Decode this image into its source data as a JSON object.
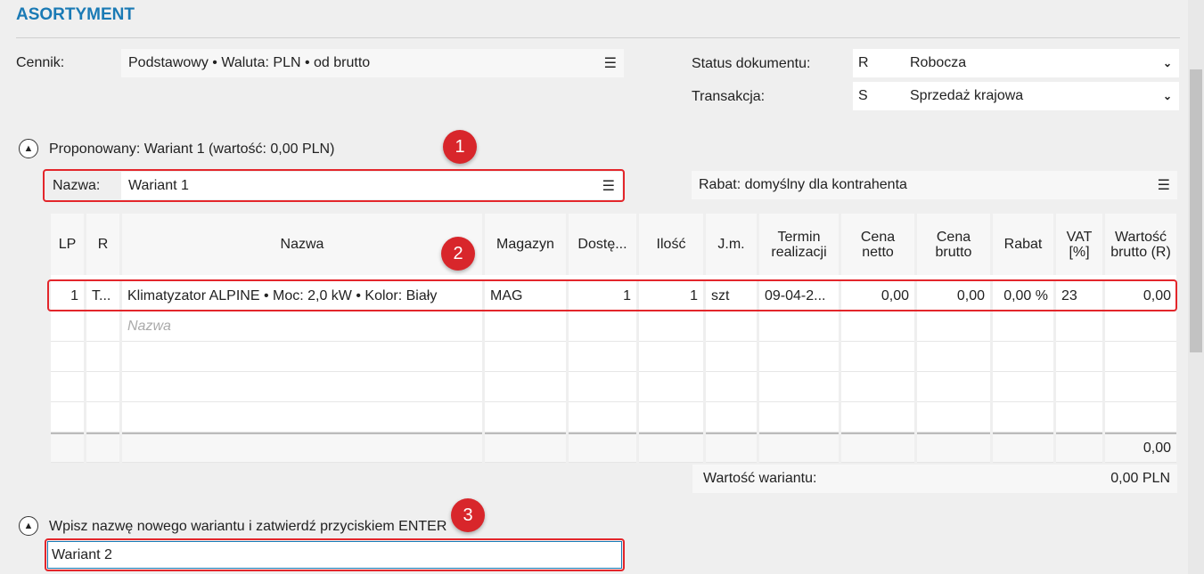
{
  "section_title": "ASORTYMENT",
  "cennik": {
    "label": "Cennik:",
    "value": "Podstawowy • Waluta: PLN • od brutto"
  },
  "status": {
    "label": "Status dokumentu:",
    "code": "R",
    "value": "Robocza"
  },
  "transakcja": {
    "label": "Transakcja:",
    "code": "S",
    "value": "Sprzedaż krajowa"
  },
  "proposed": {
    "title": "Proponowany: Wariant 1 (wartość: 0,00 PLN)",
    "name_label": "Nazwa:",
    "name_value": "Wariant 1",
    "rabat": "Rabat: domyślny dla kontrahenta"
  },
  "badges": [
    "1",
    "2",
    "3"
  ],
  "table": {
    "headers": [
      "LP",
      "R",
      "Nazwa",
      "Magazyn",
      "Dostę...",
      "Ilość",
      "J.m.",
      "Termin realizacji",
      "Cena netto",
      "Cena brutto",
      "Rabat",
      "VAT [%]",
      "Wartość brutto (R)"
    ],
    "row": [
      "1",
      "T...",
      "Klimatyzator ALPINE • Moc: 2,0 kW • Kolor: Biały",
      "MAG",
      "1",
      "1",
      "szt",
      "09-04-2...",
      "0,00",
      "0,00",
      "0,00 %",
      "23",
      "0,00"
    ],
    "new_row_placeholder": "Nazwa",
    "total": "0,00"
  },
  "variant_value": {
    "label": "Wartość wariantu:",
    "value": "0,00 PLN"
  },
  "new_variant": {
    "title": "Wpisz nazwę nowego wariantu i zatwierdź przyciskiem ENTER",
    "value": "Wariant 2"
  }
}
